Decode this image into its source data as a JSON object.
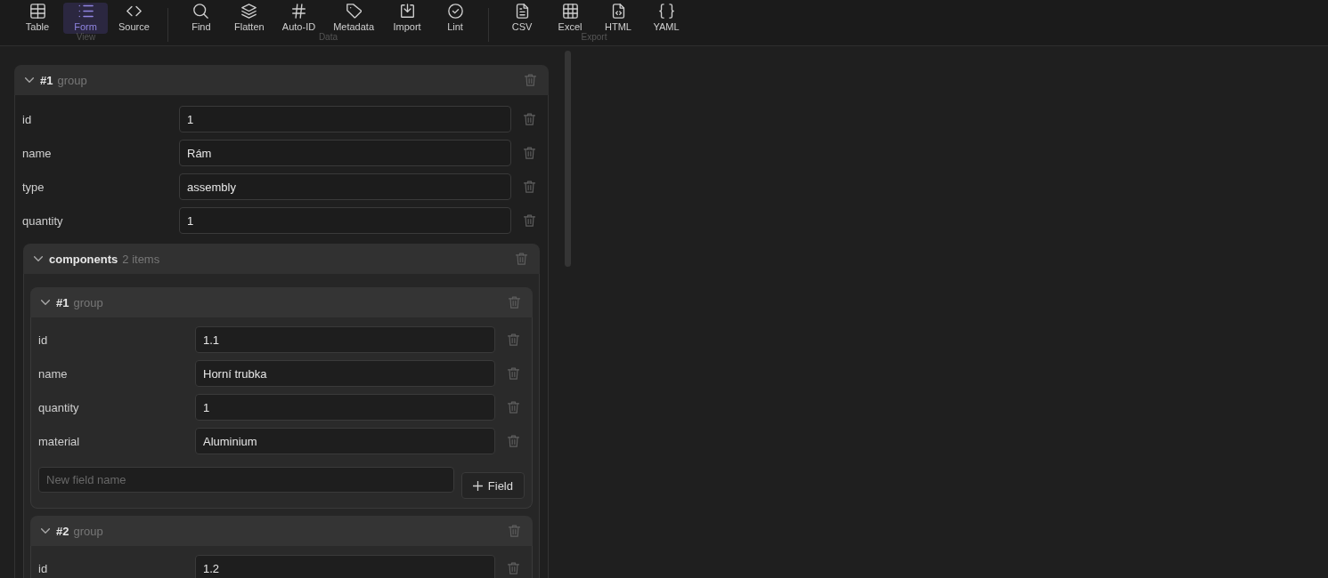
{
  "toolbar": {
    "groups": [
      {
        "label": "View",
        "items": [
          {
            "label": "Table",
            "selected": false
          },
          {
            "label": "Form",
            "selected": true
          },
          {
            "label": "Source",
            "selected": false
          }
        ]
      },
      {
        "label": "Data",
        "items": [
          {
            "label": "Find",
            "selected": false
          },
          {
            "label": "Flatten",
            "selected": false
          },
          {
            "label": "Auto-ID",
            "selected": false
          },
          {
            "label": "Metadata",
            "selected": false
          },
          {
            "label": "Import",
            "selected": false
          },
          {
            "label": "Lint",
            "selected": false
          }
        ]
      },
      {
        "label": "Export",
        "items": [
          {
            "label": "CSV",
            "selected": false
          },
          {
            "label": "Excel",
            "selected": false
          },
          {
            "label": "HTML",
            "selected": false
          },
          {
            "label": "YAML",
            "selected": false
          }
        ]
      }
    ]
  },
  "form": {
    "groups": [
      {
        "index": "#1",
        "type": "group",
        "expanded": true,
        "entries": [
          {
            "kind": "field",
            "label": "id",
            "value": "1"
          },
          {
            "kind": "field",
            "label": "name",
            "value": "Rám"
          },
          {
            "kind": "field",
            "label": "type",
            "value": "assembly"
          },
          {
            "kind": "field",
            "label": "quantity",
            "value": "1"
          },
          {
            "kind": "list",
            "label": "components",
            "count": "2 items",
            "expanded": true,
            "groups": [
              {
                "index": "#1",
                "type": "group",
                "expanded": true,
                "entries": [
                  {
                    "kind": "field",
                    "label": "id",
                    "value": "1.1"
                  },
                  {
                    "kind": "field",
                    "label": "name",
                    "value": "Horní trubka"
                  },
                  {
                    "kind": "field",
                    "label": "quantity",
                    "value": "1"
                  },
                  {
                    "kind": "field",
                    "label": "material",
                    "value": "Aluminium"
                  }
                ],
                "new_field": {
                  "placeholder": "New field name",
                  "button": "Field"
                }
              },
              {
                "index": "#2",
                "type": "group",
                "expanded": true,
                "entries": [
                  {
                    "kind": "field",
                    "label": "id",
                    "value": "1.2"
                  }
                ]
              }
            ]
          }
        ]
      }
    ]
  }
}
